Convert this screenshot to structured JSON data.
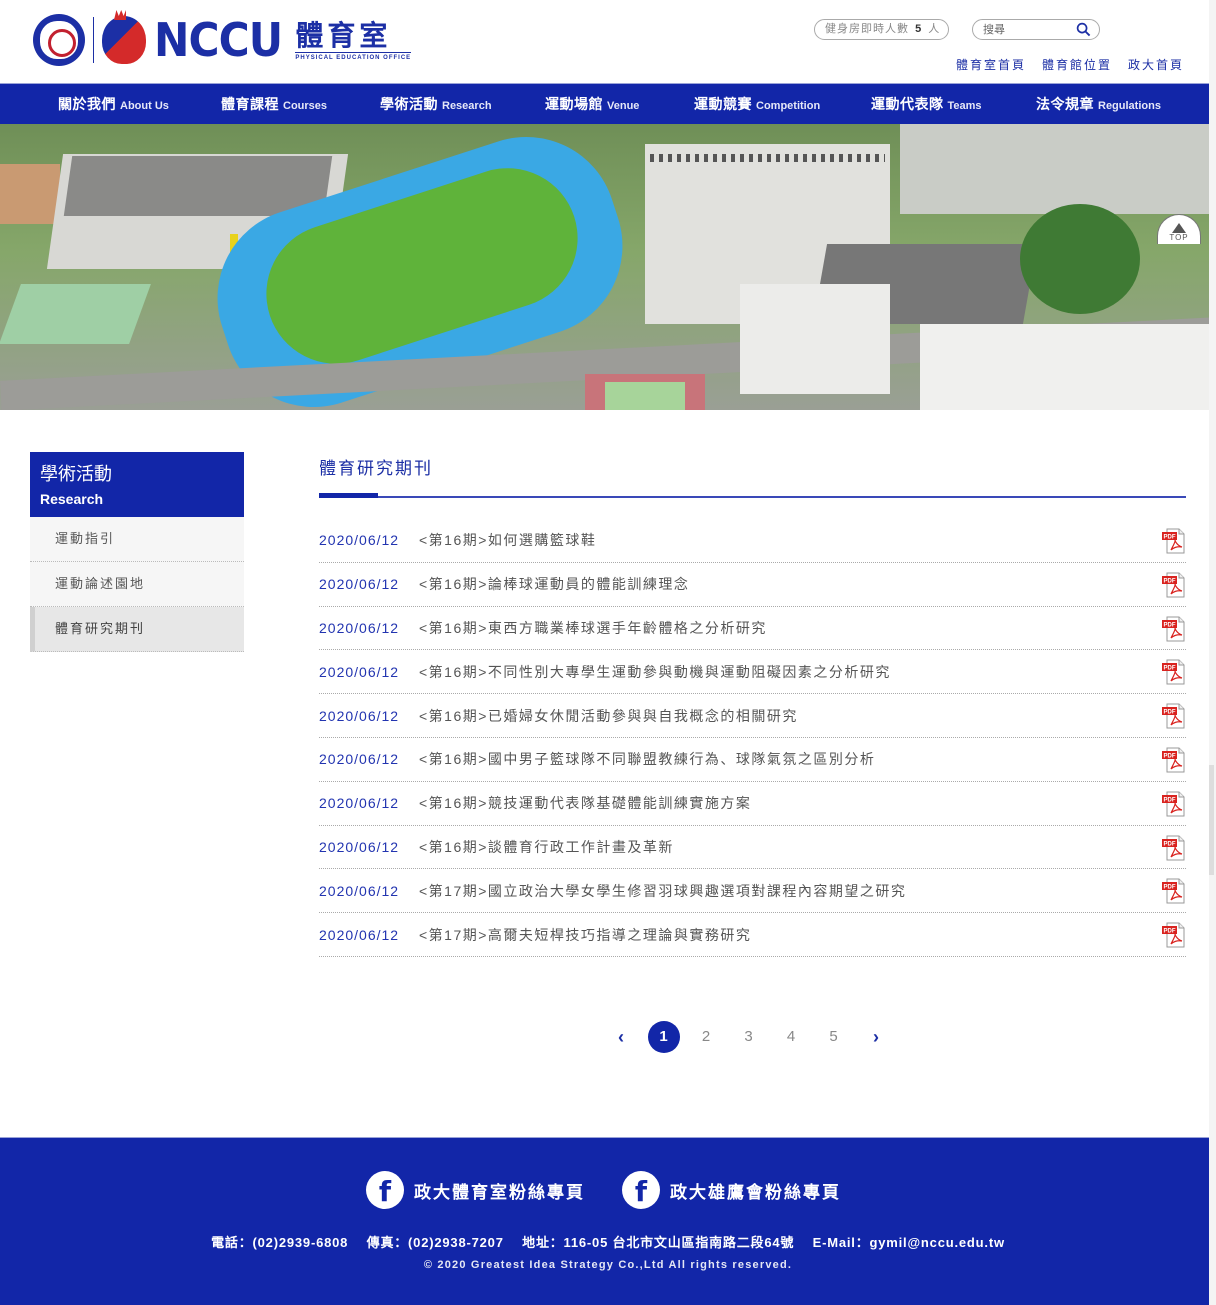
{
  "header": {
    "logo_wordmark": "NCCU",
    "office_cn": "體育室",
    "office_en": "PHYSICAL EDUCATION OFFICE",
    "gym_count_prefix": "健身房即時人數",
    "gym_count_value": "5",
    "gym_count_suffix": "人",
    "search_placeholder": "搜尋",
    "top_links": [
      "體育室首頁",
      "體育館位置",
      "政大首頁"
    ]
  },
  "nav": [
    {
      "cn": "關於我們",
      "en": "About Us"
    },
    {
      "cn": "體育課程",
      "en": "Courses"
    },
    {
      "cn": "學術活動",
      "en": "Research"
    },
    {
      "cn": "運動場館",
      "en": "Venue"
    },
    {
      "cn": "運動競賽",
      "en": "Competition"
    },
    {
      "cn": "運動代表隊",
      "en": "Teams"
    },
    {
      "cn": "法令規章",
      "en": "Regulations"
    }
  ],
  "top_button": "TOP",
  "sidebar": {
    "title_cn": "學術活動",
    "title_en": "Research",
    "items": [
      {
        "label": "運動指引",
        "active": false
      },
      {
        "label": "運動論述園地",
        "active": false
      },
      {
        "label": "體育研究期刊",
        "active": true
      }
    ]
  },
  "main": {
    "title": "體育研究期刊",
    "items": [
      {
        "date": "2020/06/12",
        "title": "<第16期>如何選購籃球鞋"
      },
      {
        "date": "2020/06/12",
        "title": "<第16期>論棒球運動員的體能訓練理念"
      },
      {
        "date": "2020/06/12",
        "title": "<第16期>東西方職業棒球選手年齡體格之分析研究"
      },
      {
        "date": "2020/06/12",
        "title": "<第16期>不同性別大專學生運動參與動機與運動阻礙因素之分析研究"
      },
      {
        "date": "2020/06/12",
        "title": "<第16期>已婚婦女休閒活動參與與自我概念的相關研究"
      },
      {
        "date": "2020/06/12",
        "title": "<第16期>國中男子籃球隊不同聯盟教練行為、球隊氣氛之區別分析"
      },
      {
        "date": "2020/06/12",
        "title": "<第16期>競技運動代表隊基礎體能訓練實施方案"
      },
      {
        "date": "2020/06/12",
        "title": "<第16期>談體育行政工作計畫及革新"
      },
      {
        "date": "2020/06/12",
        "title": "<第17期>國立政治大學女學生修習羽球興趣選項對課程內容期望之研究"
      },
      {
        "date": "2020/06/12",
        "title": "<第17期>高爾夫短桿技巧指導之理論與實務研究"
      }
    ],
    "file_icon": "pdf-icon"
  },
  "pagination": {
    "prev": "‹",
    "next": "›",
    "pages": [
      "1",
      "2",
      "3",
      "4",
      "5"
    ],
    "current": "1"
  },
  "footer": {
    "fb_links": [
      "政大體育室粉絲專頁",
      "政大雄鷹會粉絲專頁"
    ],
    "phone": "電話：(02)2939-6808",
    "fax": "傳真：(02)2938-7207",
    "address": "地址：116-05 台北市文山區指南路二段64號",
    "email": "E-Mail：gymil@nccu.edu.tw",
    "copyright": "© 2020 Greatest Idea Strategy Co.,Ltd All rights reserved."
  },
  "colors": {
    "brand_blue": "#1226a8",
    "link_blue": "#1c2fa5",
    "date_blue": "#2234b0"
  }
}
